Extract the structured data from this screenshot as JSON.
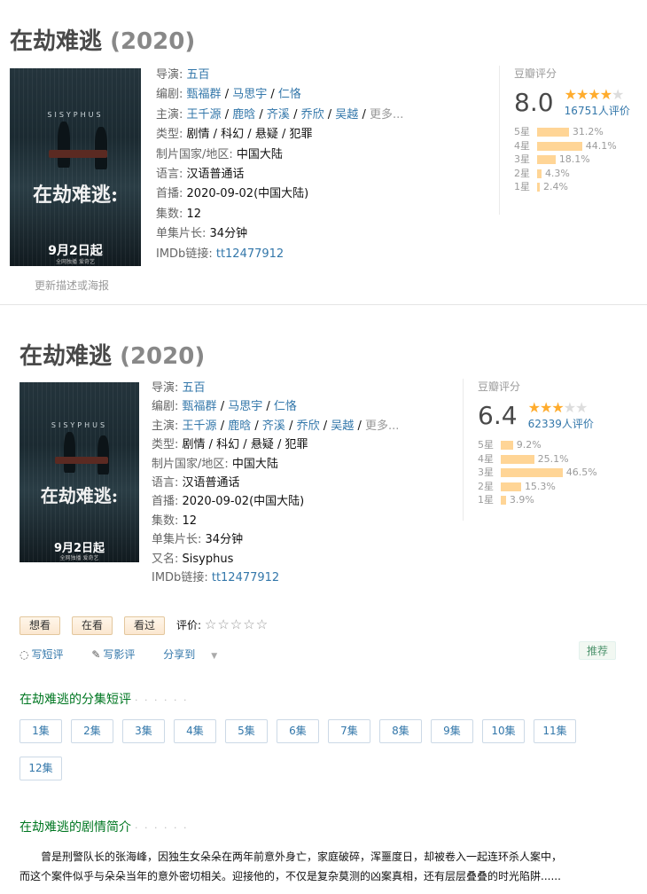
{
  "block1": {
    "title": "在劫难逃",
    "year": "(2020)",
    "poster": {
      "brand": "SISYPHUS",
      "calli": "在劫难逃:",
      "date": "9月2日起",
      "small": "全网独播 爱奇艺"
    },
    "update_link": "更新描述或海报",
    "info": {
      "director_label": "导演:",
      "director": [
        "五百"
      ],
      "writer_label": "编剧:",
      "writers": [
        "甄福群",
        "马思宇",
        "仁恪"
      ],
      "cast_label": "主演:",
      "cast": [
        "王千源",
        "鹿晗",
        "齐溪",
        "乔欣",
        "吴越"
      ],
      "cast_more": "更多...",
      "genre_label": "类型:",
      "genre": "剧情 / 科幻 / 悬疑 / 犯罪",
      "country_label": "制片国家/地区:",
      "country": "中国大陆",
      "language_label": "语言:",
      "language": "汉语普通话",
      "premiere_label": "首播:",
      "premiere": "2020-09-02(中国大陆)",
      "episodes_label": "集数:",
      "episodes": "12",
      "runtime_label": "单集片长:",
      "runtime": "34分钟",
      "imdb_label": "IMDb链接:",
      "imdb": "tt12477912"
    },
    "rating": {
      "label": "豆瓣评分",
      "score": "8.0",
      "stars_on": 4,
      "votes": "16751人评价",
      "bars": [
        {
          "label": "5星",
          "pct": 31.2,
          "text": "31.2%"
        },
        {
          "label": "4星",
          "pct": 44.1,
          "text": "44.1%"
        },
        {
          "label": "3星",
          "pct": 18.1,
          "text": "18.1%"
        },
        {
          "label": "2星",
          "pct": 4.3,
          "text": "4.3%"
        },
        {
          "label": "1星",
          "pct": 2.4,
          "text": "2.4%"
        }
      ]
    }
  },
  "block2": {
    "title": "在劫难逃",
    "year": "(2020)",
    "poster": {
      "brand": "SISYPHUS",
      "calli": "在劫难逃:",
      "date": "9月2日起",
      "small": "全网独播 爱奇艺"
    },
    "info": {
      "director_label": "导演:",
      "director": [
        "五百"
      ],
      "writer_label": "编剧:",
      "writers": [
        "甄福群",
        "马思宇",
        "仁恪"
      ],
      "cast_label": "主演:",
      "cast": [
        "王千源",
        "鹿晗",
        "齐溪",
        "乔欣",
        "吴越"
      ],
      "cast_more": "更多...",
      "genre_label": "类型:",
      "genre": "剧情 / 科幻 / 悬疑 / 犯罪",
      "country_label": "制片国家/地区:",
      "country": "中国大陆",
      "language_label": "语言:",
      "language": "汉语普通话",
      "premiere_label": "首播:",
      "premiere": "2020-09-02(中国大陆)",
      "episodes_label": "集数:",
      "episodes": "12",
      "runtime_label": "单集片长:",
      "runtime": "34分钟",
      "aka_label": "又名:",
      "aka": "Sisyphus",
      "imdb_label": "IMDb链接:",
      "imdb": "tt12477912"
    },
    "rating": {
      "label": "豆瓣评分",
      "score": "6.4",
      "stars_on": 3,
      "votes": "62339人评价",
      "bars": [
        {
          "label": "5星",
          "pct": 9.2,
          "text": "9.2%"
        },
        {
          "label": "4星",
          "pct": 25.1,
          "text": "25.1%"
        },
        {
          "label": "3星",
          "pct": 46.5,
          "text": "46.5%"
        },
        {
          "label": "2星",
          "pct": 15.3,
          "text": "15.3%"
        },
        {
          "label": "1星",
          "pct": 3.9,
          "text": "3.9%"
        }
      ]
    }
  },
  "actions": {
    "want": "想看",
    "watching": "在看",
    "watched": "看过",
    "my_rating_label": "评价:",
    "short_review": "写短评",
    "review": "写影评",
    "share": "分享到",
    "recommend": "推荐"
  },
  "episodes_section": {
    "title": "在劫难逃的分集短评",
    "dots": "· · · · · ·",
    "items": [
      "1集",
      "2集",
      "3集",
      "4集",
      "5集",
      "6集",
      "7集",
      "8集",
      "9集",
      "10集",
      "11集",
      "12集"
    ]
  },
  "synopsis": {
    "title": "在劫难逃的剧情简介",
    "dots": "· · · · · ·",
    "line1": "曾是刑警队长的张海峰，因独生女朵朵在两年前意外身亡，家庭破碎，浑噩度日，却被卷入一起连环杀人案中，",
    "line2": "而这个案件似乎与朵朵当年的意外密切相关。迎接他的，不仅是复杂莫测的凶案真相，还有层层叠叠的时光陷阱......"
  },
  "colors": {
    "link": "#3377aa",
    "star": "#ffac2d",
    "bar": "#ffd596",
    "green": "#007722"
  }
}
